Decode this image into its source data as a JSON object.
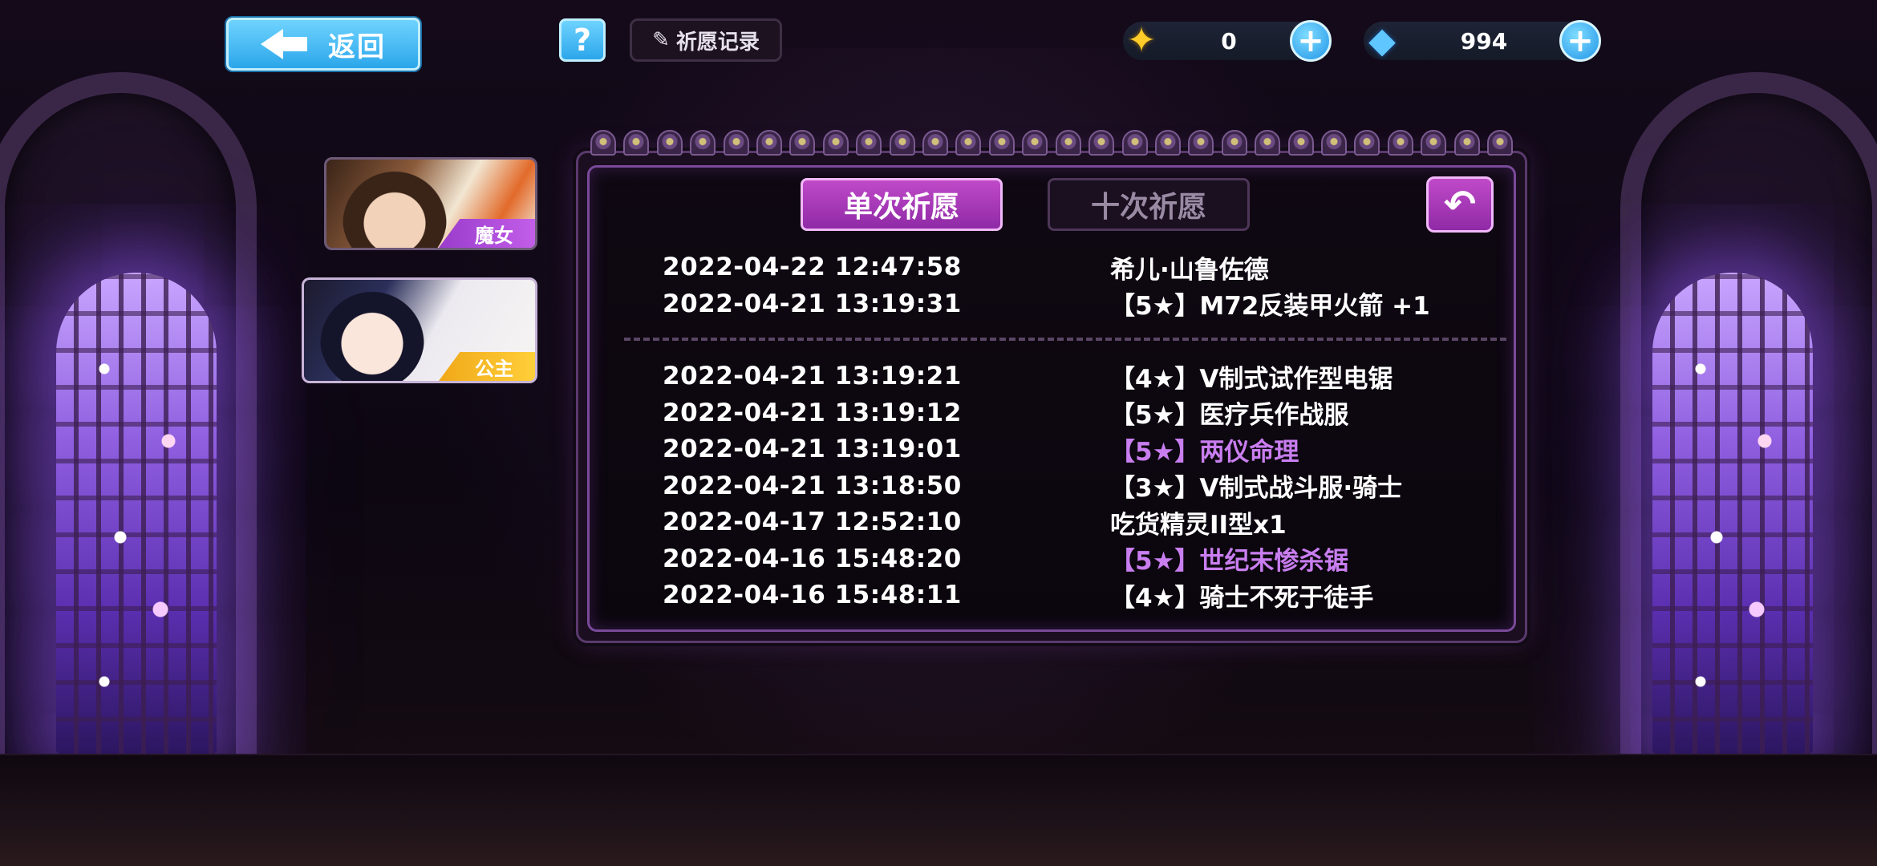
{
  "header": {
    "back_label": "返回",
    "help_label": "?",
    "record_label": "祈愿记录",
    "record_icon": "scroll-quill-icon"
  },
  "currencies": [
    {
      "name": "gold-ticket",
      "icon": "gold-ticket-icon",
      "value": "0",
      "color": "#ffcc2a"
    },
    {
      "name": "crystal",
      "icon": "blue-crystal-icon",
      "value": "994",
      "color": "#5fc6ff"
    }
  ],
  "character_tabs": [
    {
      "tag": "魔女",
      "color": "#b44fe0"
    },
    {
      "tag": "公主",
      "color": "#f5b822"
    }
  ],
  "tabs": {
    "single": "单次祈愿",
    "ten": "十次祈愿",
    "active": "single"
  },
  "records_top": [
    {
      "time": "2022-04-22 12:47:58",
      "item": "希儿·山鲁佐德",
      "highlight": false
    },
    {
      "time": "2022-04-21 13:19:31",
      "item": "【5★】M72反装甲火箭 +1",
      "highlight": false
    }
  ],
  "records": [
    {
      "time": "2022-04-21 13:19:21",
      "item": "【4★】V制式试作型电锯",
      "highlight": false
    },
    {
      "time": "2022-04-21 13:19:12",
      "item": "【5★】医疗兵作战服",
      "highlight": false
    },
    {
      "time": "2022-04-21 13:19:01",
      "item": "【5★】两仪命理",
      "highlight": true
    },
    {
      "time": "2022-04-21 13:18:50",
      "item": "【3★】V制式战斗服·骑士",
      "highlight": false
    },
    {
      "time": "2022-04-17 12:52:10",
      "item": "吃货精灵II型x1",
      "highlight": false
    },
    {
      "time": "2022-04-16 15:48:20",
      "item": "【5★】世纪末惨杀锯",
      "highlight": true
    },
    {
      "time": "2022-04-16 15:48:11",
      "item": "【4★】骑士不死于徒手",
      "highlight": false
    }
  ],
  "colors": {
    "highlight": "#c97ef0",
    "accent": "#b640c4",
    "button_blue": "#3bb4f0"
  }
}
